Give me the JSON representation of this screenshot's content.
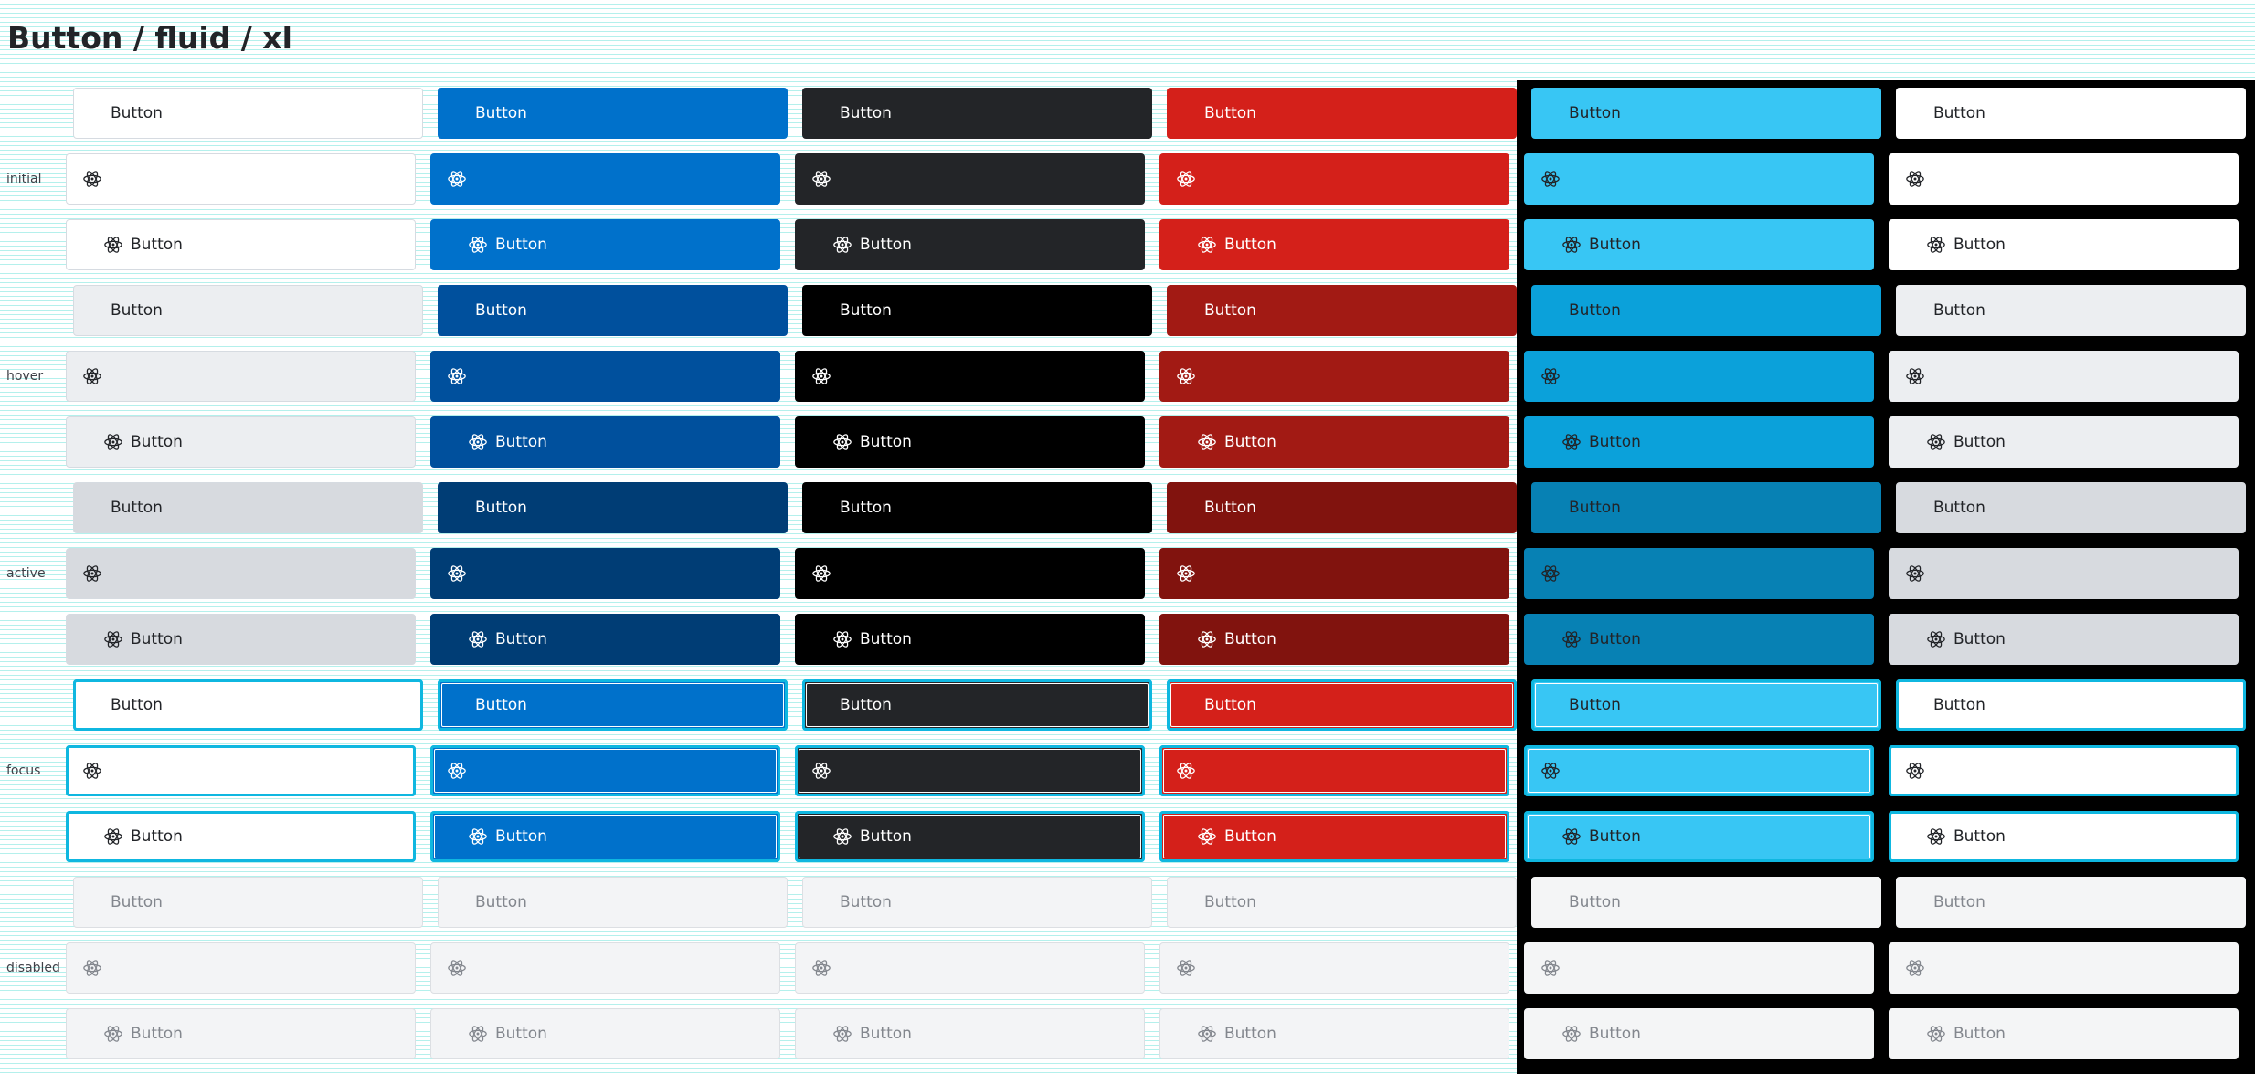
{
  "page": {
    "title": "Button / fluid / xl"
  },
  "states": [
    "initial",
    "hover",
    "active",
    "focus",
    "disabled"
  ],
  "variants": [
    "default",
    "primary",
    "dark",
    "danger",
    "primary-on-dark",
    "default-on-dark"
  ],
  "button": {
    "label": "Button",
    "icon": "atom-icon"
  },
  "colors": {
    "initial": {
      "bg": [
        "#ffffff",
        "#0071cb",
        "#232528",
        "#d4201a",
        "#38c6f4",
        "#ffffff"
      ],
      "fg": [
        "#222428",
        "#ffffff",
        "#ffffff",
        "#ffffff",
        "#222428",
        "#222428"
      ],
      "border": [
        "#d6dbe1",
        "#0071cb",
        "#232528",
        "#d4201a",
        "#38c6f4",
        "#ffffff"
      ]
    },
    "hover": {
      "bg": [
        "#eceef1",
        "#00509d",
        "#000000",
        "#a21a14",
        "#0ba1da",
        "#eceef1"
      ],
      "fg": [
        "#222428",
        "#ffffff",
        "#ffffff",
        "#ffffff",
        "#222428",
        "#222428"
      ],
      "border": [
        "#d6dbe1",
        "#00509d",
        "#000000",
        "#a21a14",
        "#0ba1da",
        "#eceef1"
      ]
    },
    "active": {
      "bg": [
        "#d7dadf",
        "#003d75",
        "#000000",
        "#81130e",
        "#0781b4",
        "#d7dadf"
      ],
      "fg": [
        "#222428",
        "#ffffff",
        "#ffffff",
        "#ffffff",
        "#222428",
        "#222428"
      ],
      "border": [
        "#d6dbe1",
        "#003d75",
        "#000000",
        "#81130e",
        "#0781b4",
        "#d7dadf"
      ]
    },
    "focus": {
      "bg": [
        "#ffffff",
        "#0071cb",
        "#232528",
        "#d4201a",
        "#38c6f4",
        "#ffffff"
      ],
      "fg": [
        "#222428",
        "#ffffff",
        "#ffffff",
        "#ffffff",
        "#222428",
        "#222428"
      ],
      "border": [
        "#0fb7e0",
        "#0fb7e0",
        "#0fb7e0",
        "#0fb7e0",
        "#0fb7e0",
        "#0fb7e0"
      ]
    },
    "disabled": {
      "bg": [
        "#f3f4f6",
        "#f3f4f6",
        "#f3f4f6",
        "#f3f4f6",
        "#f4f5f6",
        "#f4f5f6"
      ],
      "fg": [
        "#83878e",
        "#83878e",
        "#83878e",
        "#83878e",
        "#83878e",
        "#83878e"
      ],
      "border": [
        "#dcdfe3",
        "#dcdfe3",
        "#dcdfe3",
        "#dcdfe3",
        "#f4f5f6",
        "#f4f5f6"
      ]
    }
  }
}
